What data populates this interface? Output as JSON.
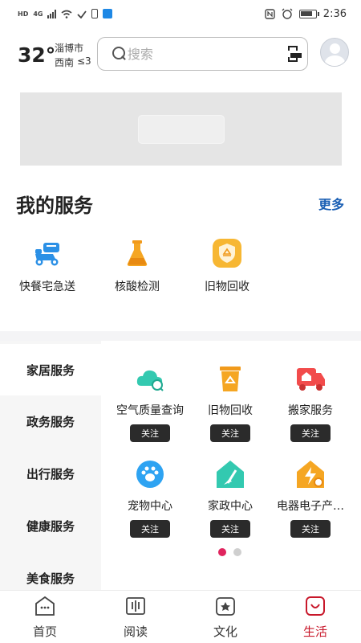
{
  "status_bar": {
    "left_text": "HD",
    "network": "4G",
    "time": "2:36"
  },
  "weather": {
    "temperature": "32°",
    "city": "淄博市",
    "wind": "西南",
    "level": "≤3"
  },
  "search": {
    "placeholder": "搜索"
  },
  "my_services": {
    "title": "我的服务",
    "more": "更多",
    "items": [
      {
        "label": "快餐宅急送",
        "icon": "delivery-scooter-icon"
      },
      {
        "label": "核酸检测",
        "icon": "test-flask-icon"
      },
      {
        "label": "旧物回收",
        "icon": "recycle-shield-icon"
      }
    ]
  },
  "categories": [
    {
      "label": "家居服务",
      "active": true
    },
    {
      "label": "政务服务",
      "active": false
    },
    {
      "label": "出行服务",
      "active": false
    },
    {
      "label": "健康服务",
      "active": false
    },
    {
      "label": "美食服务",
      "active": false
    }
  ],
  "grid": {
    "follow_label": "关注",
    "items": [
      {
        "label": "空气质量查询",
        "icon": "air-quality-icon"
      },
      {
        "label": "旧物回收",
        "icon": "recycle-bin-icon"
      },
      {
        "label": "搬家服务",
        "icon": "moving-truck-icon"
      },
      {
        "label": "宠物中心",
        "icon": "pet-paw-icon"
      },
      {
        "label": "家政中心",
        "icon": "housekeeping-icon"
      },
      {
        "label": "电器电子产…",
        "icon": "appliance-icon"
      }
    ]
  },
  "pagination": {
    "current": 1,
    "total": 2
  },
  "bottom_nav": [
    {
      "label": "首页",
      "icon": "home-icon",
      "active": false
    },
    {
      "label": "阅读",
      "icon": "book-icon",
      "active": false
    },
    {
      "label": "文化",
      "icon": "culture-star-icon",
      "active": false
    },
    {
      "label": "生活",
      "icon": "life-smile-icon",
      "active": true
    }
  ],
  "colors": {
    "accent_active": "#c8182b",
    "more_link": "#1a5fb4",
    "pagination_active": "#e0245e"
  }
}
